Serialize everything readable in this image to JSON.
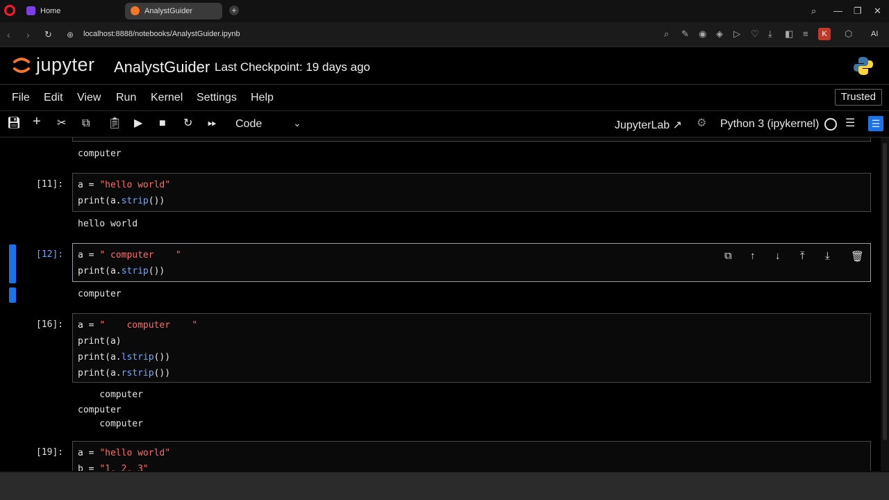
{
  "browser": {
    "tabs": [
      {
        "label": "Home",
        "icon": "opera-home-icon"
      },
      {
        "label": "AnalystGuider",
        "icon": "jupyter-tab-icon"
      }
    ],
    "url": "localhost:8888/notebooks/AnalystGuider.ipynb",
    "profile_initial": "K",
    "ai_label": "AI"
  },
  "jupyter": {
    "logo_text": "jupyter",
    "notebook_name": "AnalystGuider",
    "checkpoint": "Last Checkpoint: 19 days ago",
    "menu": [
      "File",
      "Edit",
      "View",
      "Run",
      "Kernel",
      "Settings",
      "Help"
    ],
    "trusted": "Trusted",
    "cell_type": "Code",
    "jupyterlab_link": "JupyterLab",
    "kernel": "Python 3 (ipykernel)"
  },
  "cells": {
    "c10_output": "computer",
    "c11": {
      "prompt": "[11]:",
      "line1_a": "a = ",
      "line1_s": "\"hello world\"",
      "line2_pre": "print(a.",
      "line2_m": "strip",
      "line2_post": "())",
      "output": "hello world"
    },
    "c12": {
      "prompt": "[12]:",
      "line1_a": "a = ",
      "line1_s": "\" computer    \"",
      "line2_pre": "print(a.",
      "line2_m": "strip",
      "line2_post": "())",
      "output": "computer"
    },
    "c16": {
      "prompt": "[16]:",
      "line1_a": "a = ",
      "line1_s": "\"    computer    \"",
      "line2": "print(a)",
      "line3_pre": "print(a.",
      "line3_m": "lstrip",
      "line3_post": "())",
      "line4_pre": "print(a.",
      "line4_m": "rstrip",
      "line4_post": "())",
      "output1": "    computer",
      "output2": "computer",
      "output3": "    computer"
    },
    "c19": {
      "prompt": "[19]:",
      "line1_a": "a = ",
      "line1_s": "\"hello world\"",
      "line2_a": "b = ",
      "line2_s": "\"1, 2, 3\""
    }
  }
}
